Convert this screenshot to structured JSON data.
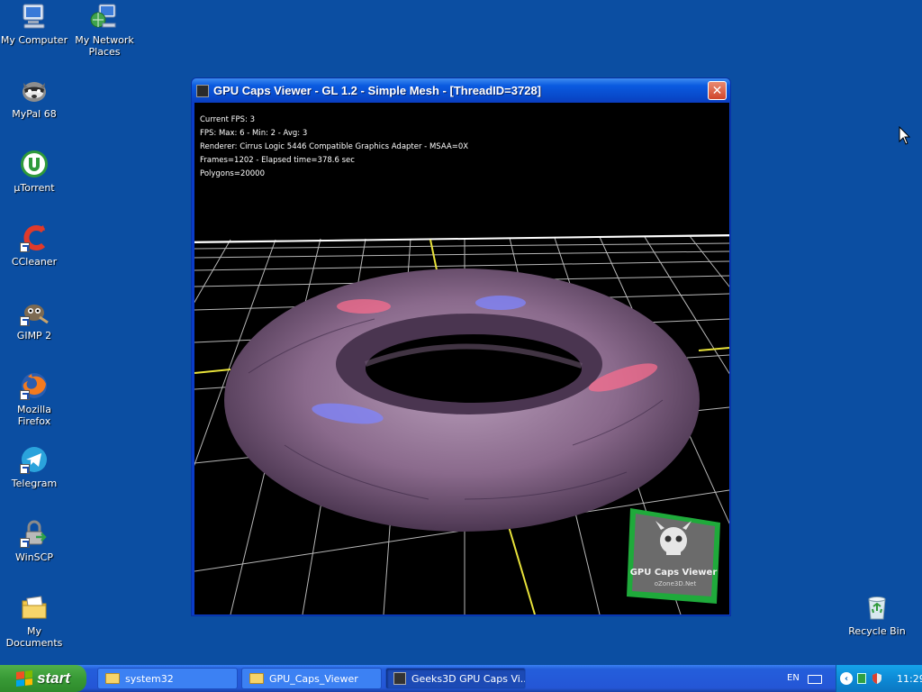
{
  "desktop": {
    "icons": [
      {
        "label": "My Computer",
        "icon": "my-computer-icon"
      },
      {
        "label": "My Network Places",
        "icon": "network-places-icon"
      },
      {
        "label": "MyPal 68",
        "icon": "mypal-icon"
      },
      {
        "label": "µTorrent",
        "icon": "utorrent-icon"
      },
      {
        "label": "CCleaner",
        "icon": "ccleaner-icon"
      },
      {
        "label": "GIMP 2",
        "icon": "gimp-icon"
      },
      {
        "label": "Mozilla Firefox",
        "icon": "firefox-icon"
      },
      {
        "label": "Telegram",
        "icon": "telegram-icon"
      },
      {
        "label": "WinSCP",
        "icon": "winscp-icon"
      },
      {
        "label": "My Documents",
        "icon": "my-documents-icon"
      },
      {
        "label": "Recycle Bin",
        "icon": "recycle-bin-icon"
      }
    ]
  },
  "window": {
    "title": "GPU Caps Viewer - GL 1.2 - Simple Mesh - [ThreadID=3728]",
    "close_label": "✕",
    "hud": {
      "line1": "Current FPS: 3",
      "line2": "FPS: Max: 6 - Min: 2 - Avg: 3",
      "line3": "Renderer: Cirrus Logic 5446 Compatible Graphics Adapter - MSAA=0X",
      "line4": "Frames=1202 - Elapsed time=378.6 sec",
      "line5": "Polygons=20000"
    },
    "badge": {
      "title": "GPU Caps Viewer",
      "subtitle": "oZone3D.Net"
    }
  },
  "taskbar": {
    "start_label": "start",
    "buttons": [
      {
        "label": "system32",
        "icon": "folder-icon"
      },
      {
        "label": "GPU_Caps_Viewer",
        "icon": "folder-icon"
      },
      {
        "label": "Geeks3D GPU Caps Vi...",
        "icon": "gpu-caps-icon"
      }
    ],
    "language": "EN",
    "clock": "11:29"
  },
  "colors": {
    "desktop": "#0b4ea2",
    "taskbar": "#245edb",
    "start": "#389a36",
    "torus": "#8a6a8c"
  }
}
